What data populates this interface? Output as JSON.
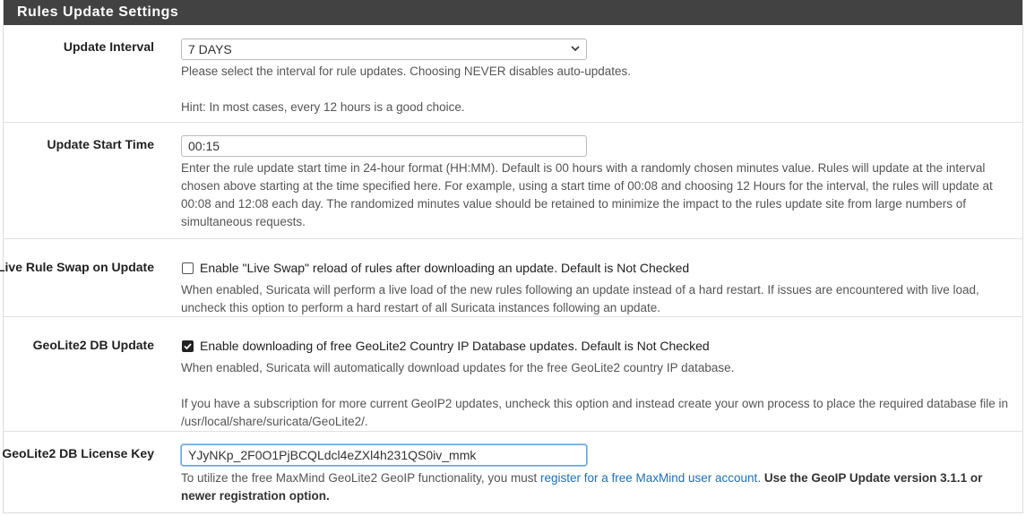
{
  "panel": {
    "title": "Rules Update Settings"
  },
  "update_interval": {
    "label": "Update Interval",
    "value": "7 DAYS",
    "help1": "Please select the interval for rule updates. Choosing NEVER disables auto-updates.",
    "help2": "Hint: In most cases, every 12 hours is a good choice."
  },
  "update_start_time": {
    "label": "Update Start Time",
    "value": "00:15",
    "help": "Enter the rule update start time in 24-hour format (HH:MM). Default is 00 hours with a randomly chosen minutes value. Rules will update at the interval chosen above starting at the time specified here. For example, using a start time of 00:08 and choosing 12 Hours for the interval, the rules will update at 00:08 and 12:08 each day. The randomized minutes value should be retained to minimize the impact to the rules update site from large numbers of simultaneous requests."
  },
  "live_swap": {
    "label": "Live Rule Swap on Update",
    "checkbox_label": "Enable \"Live Swap\" reload of rules after downloading an update. Default is Not Checked",
    "checked": false,
    "help": "When enabled, Suricata will perform a live load of the new rules following an update instead of a hard restart. If issues are encountered with live load, uncheck this option to perform a hard restart of all Suricata instances following an update."
  },
  "geolite_update": {
    "label": "GeoLite2 DB Update",
    "checkbox_label": "Enable downloading of free GeoLite2 Country IP Database updates. Default is Not Checked",
    "checked": true,
    "help1": "When enabled, Suricata will automatically download updates for the free GeoLite2 country IP database.",
    "help2": "If you have a subscription for more current GeoIP2 updates, uncheck this option and instead create your own process to place the required database file in /usr/local/share/suricata/GeoLite2/."
  },
  "geolite_key": {
    "label": "GeoLite2 DB License Key",
    "value": "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",
    "help_prefix": "To utilize the free MaxMind GeoLite2 GeoIP functionality, you must ",
    "link_text": "register for a free MaxMind user account",
    "help_mid": ". ",
    "help_strong": "Use the GeoIP Update version 3.1.1 or newer registration option."
  }
}
